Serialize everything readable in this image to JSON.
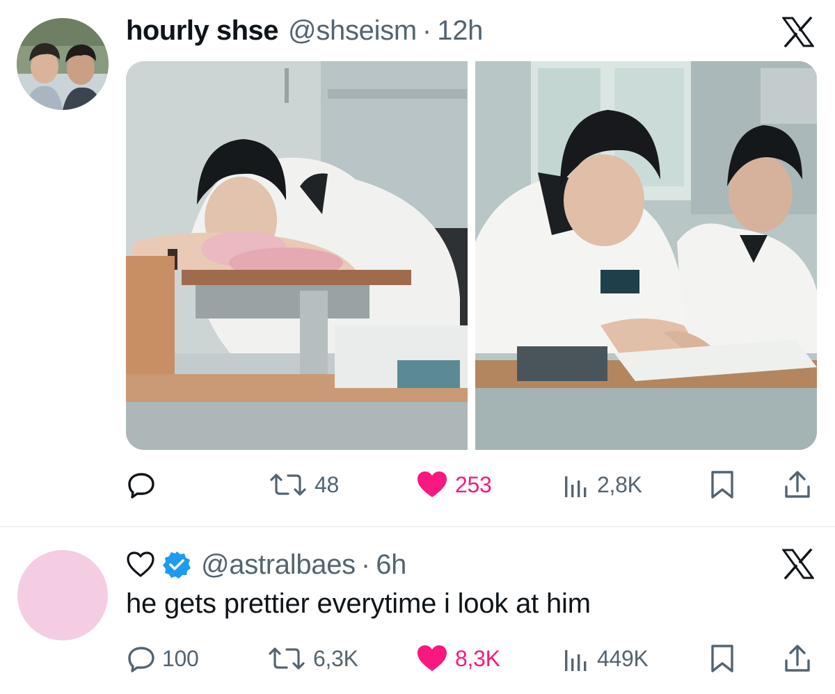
{
  "tweets": [
    {
      "display_name": "hourly shse",
      "handle": "@shseism",
      "separator": "·",
      "time": "12h",
      "logo_icon": "x-logo-icon",
      "media": [
        "classroom-photo-sleeping",
        "classroom-photo-writing"
      ],
      "actions": {
        "reply_count": "",
        "retweet_count": "48",
        "like_count": "253",
        "view_count": "2,8K"
      }
    },
    {
      "display_name": "",
      "handle": "@astralbaes",
      "separator": "·",
      "time": "6h",
      "verified": true,
      "logo_icon": "x-logo-icon",
      "text": "he gets prettier everytime i look at him",
      "actions": {
        "reply_count": "100",
        "retweet_count": "6,3K",
        "like_count": "8,3K",
        "view_count": "449K"
      }
    }
  ],
  "colors": {
    "like": "#f91880",
    "muted": "#536471",
    "text": "#0f1419",
    "verified": "#1d9bf0",
    "divider": "#e6e6e6",
    "avatar2": "#f5cde3"
  },
  "icons": {
    "reply": "reply-icon",
    "retweet": "retweet-icon",
    "like": "heart-filled-icon",
    "views": "views-icon",
    "bookmark": "bookmark-icon",
    "share": "share-icon",
    "outline_heart": "heart-outline-icon",
    "verified": "verified-badge-icon"
  }
}
